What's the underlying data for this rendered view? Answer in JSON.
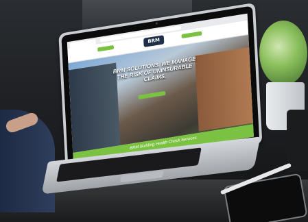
{
  "scene": {
    "description_type": "photo of laptop displaying website",
    "colors": {
      "accent": "#7cc242",
      "logo_bg": "#1f2f4a"
    }
  },
  "website": {
    "logo": "BRM",
    "hero_title": "BRM SOLUTIONS. WE MANAGE THE RISK OF UNINSURABLE CLAIMS.",
    "services_heading": "BRM Building Health Check Services"
  },
  "icons": [
    "webcam-icon"
  ]
}
